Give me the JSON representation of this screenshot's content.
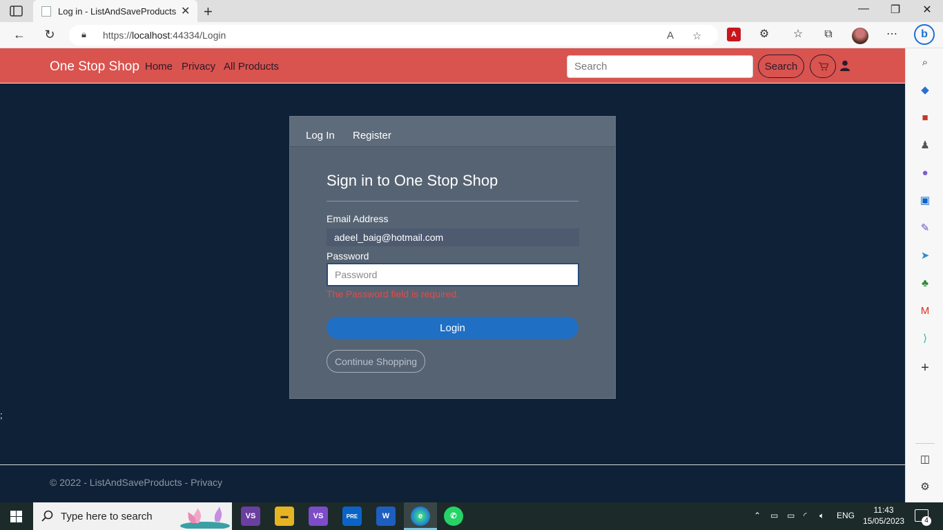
{
  "browser": {
    "tab_title": "Log in - ListAndSaveProducts",
    "url_prefix": "https://",
    "url_host": "localhost",
    "url_rest": ":44334/Login"
  },
  "site": {
    "brand": "One Stop Shop",
    "nav": [
      "Home",
      "Privacy",
      "All Products"
    ],
    "search_placeholder": "Search",
    "search_button": "Search",
    "brand_color": "#d9534f"
  },
  "login_card": {
    "tabs": [
      "Log In",
      "Register"
    ],
    "title": "Sign in to One Stop Shop",
    "email_label": "Email Address",
    "email_value": "adeel_baig@hotmail.com",
    "password_label": "Password",
    "password_placeholder": "Password",
    "error_message": "The Password field is required.",
    "login_button": "Login",
    "continue_button": "Continue Shopping"
  },
  "stray_text": ";",
  "footer": {
    "text": "© 2022 - ListAndSaveProducts - ",
    "privacy_link": "Privacy"
  },
  "taskbar": {
    "search_placeholder": "Type here to search",
    "language": "ENG",
    "time": "11:43",
    "date": "15/05/2023",
    "notification_count": "4",
    "outlook_badge": "PRE"
  }
}
